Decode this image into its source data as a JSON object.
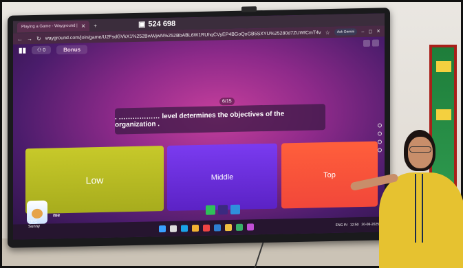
{
  "browser": {
    "tab_title": "Playing a Game - Wayground |",
    "url": "wayground.com/join/game/U2FsdGVkX1%252BwWjwN%252BbABL6W1RUhqCVyEP4BGoQoGB5SXYU%25280d7ZUWfCmT4vzfx",
    "ask_gemini": "Ask Gemini",
    "verify_label": "Verify it's you"
  },
  "overlay": {
    "counter": "524 698"
  },
  "game": {
    "score": "0",
    "bonus_label": "Bonus",
    "progress": "6/15",
    "question": ". ……………… level determines the objectives of the organization .",
    "answers": [
      {
        "label": "Low",
        "color": "#c7c92a"
      },
      {
        "label": "Middle",
        "color": "#6b2fe0"
      },
      {
        "label": "Top",
        "color": "#ff5a3a"
      }
    ],
    "player_name": "me"
  },
  "taskbar": {
    "weather_temp": "29°C",
    "weather_desc": "Sunny",
    "lang": "ENG IN",
    "time": "12:50",
    "date": "20-08-2025"
  },
  "icons": [
    "close-icon",
    "plus-icon",
    "back-icon",
    "forward-icon",
    "reload-icon",
    "star-icon",
    "minimize-icon",
    "maximize-icon",
    "windows-start-icon",
    "search-icon"
  ]
}
